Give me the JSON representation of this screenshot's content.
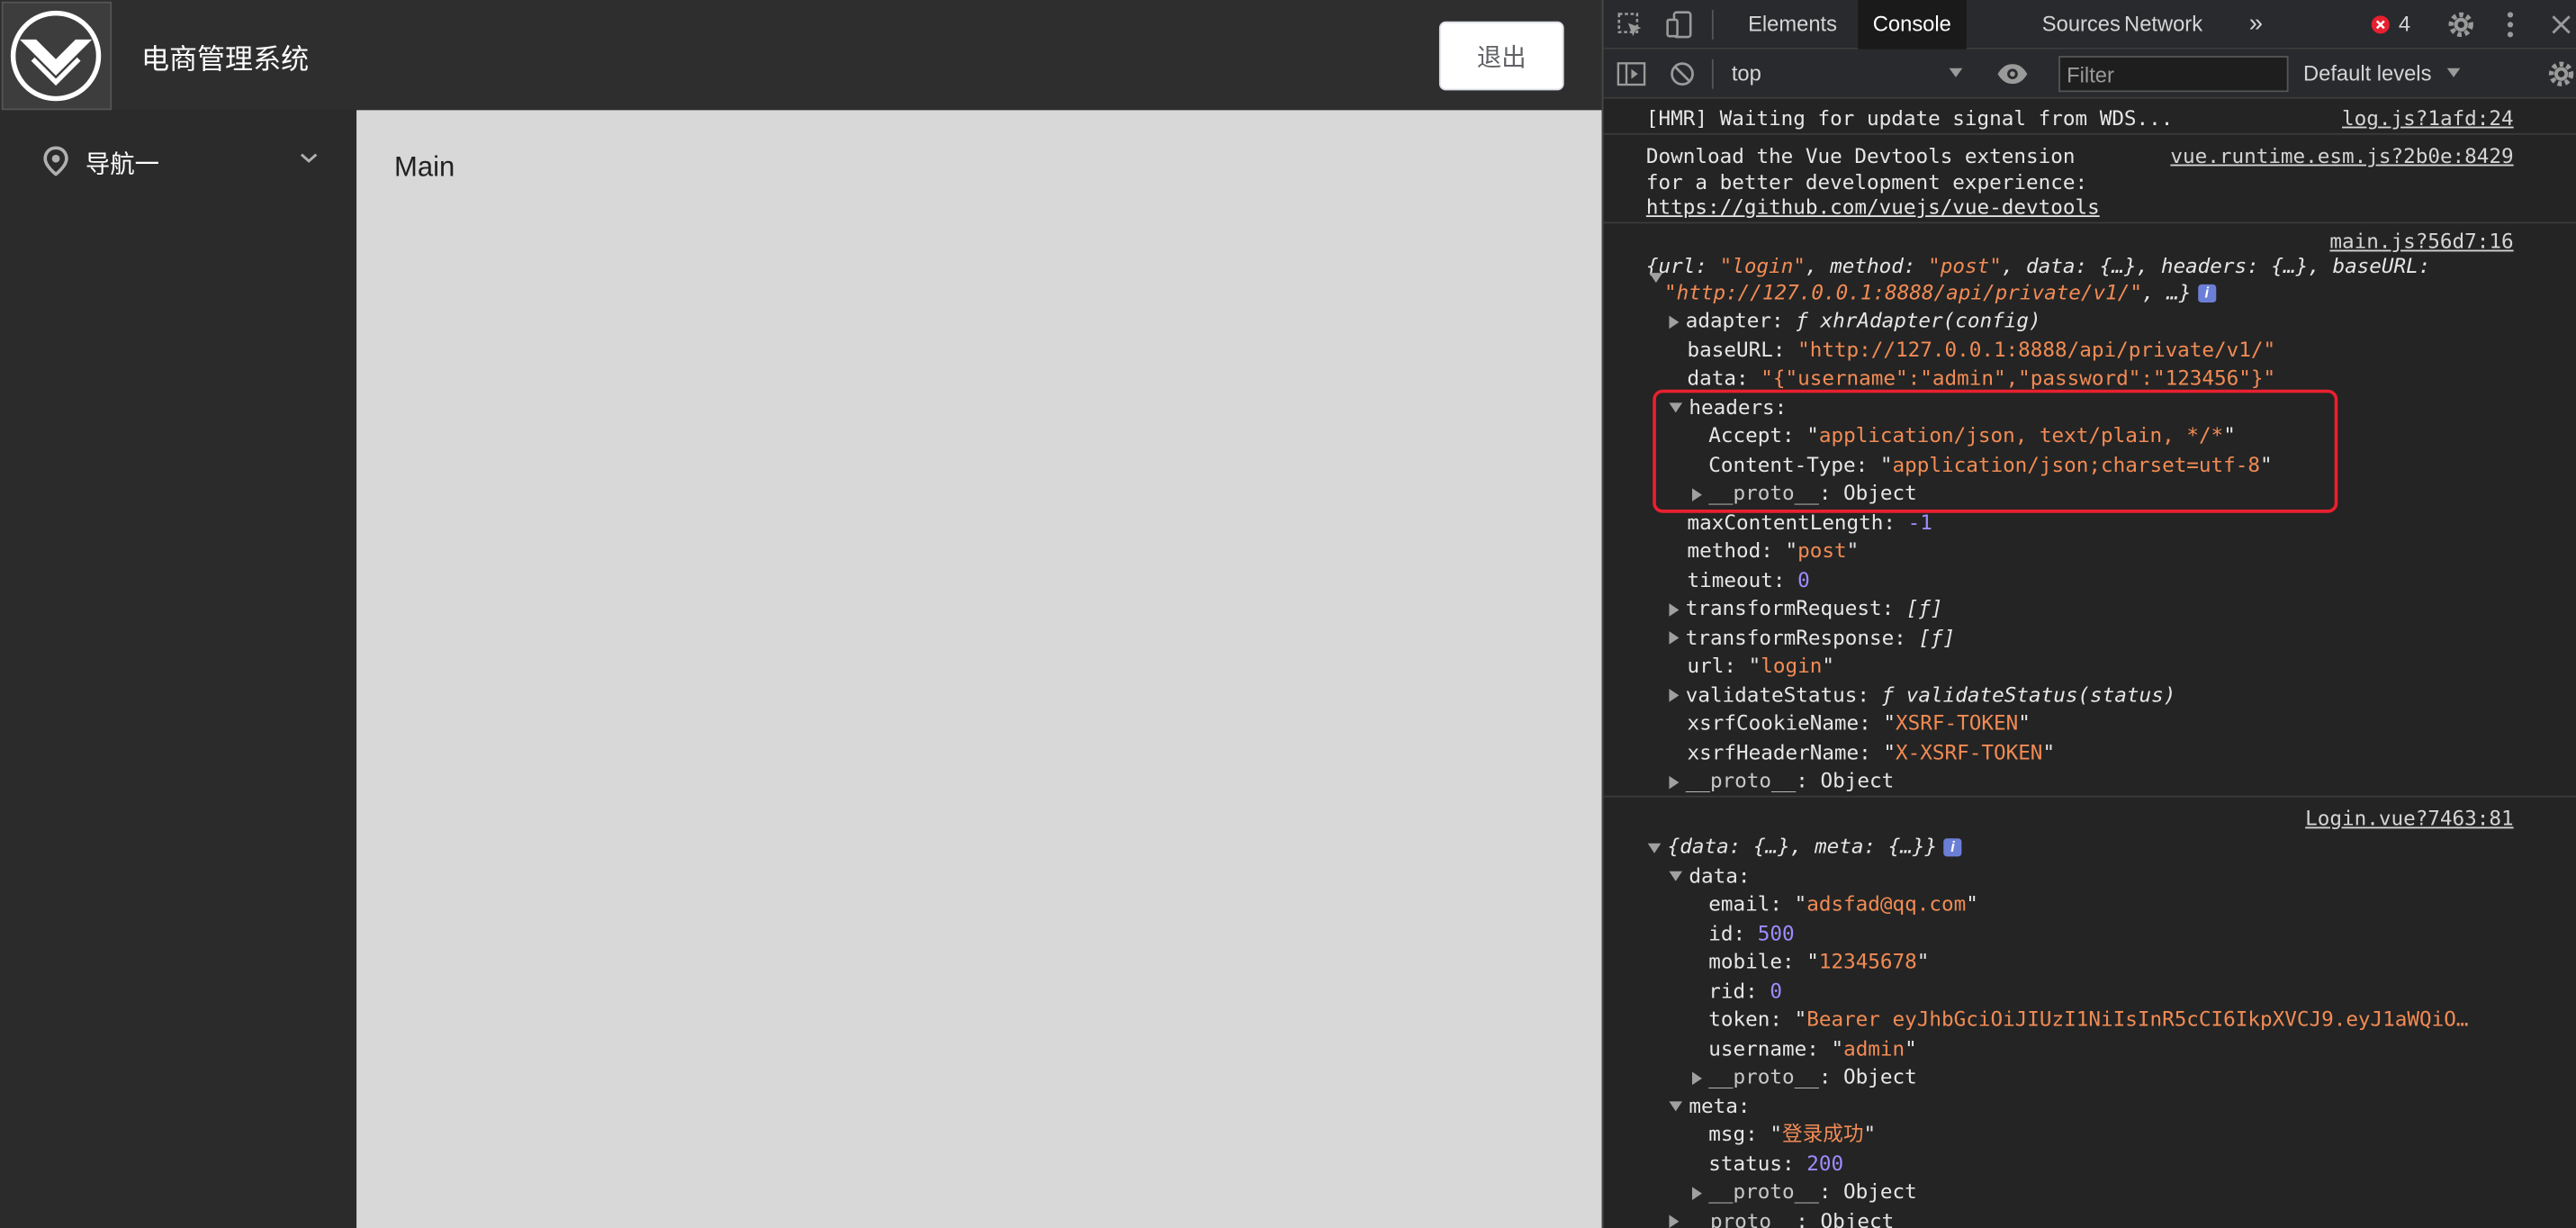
{
  "app": {
    "title": "电商管理系统",
    "logout_label": "退出",
    "nav_items": [
      {
        "label": "导航一"
      }
    ],
    "main_title": "Main"
  },
  "devtools": {
    "tabs": [
      "Elements",
      "Console",
      "Sources",
      "Network"
    ],
    "more_tabs_icon": "»",
    "error_count": "4",
    "context": "top",
    "filter_placeholder": "Filter",
    "levels": "Default levels",
    "colors": {
      "string": "#f28b54",
      "number": "#9e8cff",
      "error": "#e8202f",
      "highlight": "#e8202f"
    }
  },
  "console": {
    "msg1": {
      "text": "[HMR] Waiting for update signal from WDS...",
      "source": "log.js?1afd:24"
    },
    "msg2": {
      "line1": "Download the Vue Devtools extension",
      "line2": "for a better development experience:",
      "url": "https://github.com/vuejs/vue-devtools",
      "source": "vue.runtime.esm.js?2b0e:8429"
    },
    "msg3": {
      "source": "main.js?56d7:16",
      "summary_a": "{url: ",
      "summary_url": "\"login\"",
      "summary_b": ", method: ",
      "summary_method": "\"post\"",
      "summary_c": ", data: {…}, headers: {…}, baseURL:",
      "summary_base": "\"http://127.0.0.1:8888/api/private/v1/\"",
      "summary_end": ", …}",
      "adapter_key": "adapter: ",
      "adapter_val": "ƒ xhrAdapter(config)",
      "baseURL_key": "baseURL: ",
      "baseURL_val": "\"http://127.0.0.1:8888/api/private/v1/\"",
      "data_key": "data: ",
      "data_val": "\"{\"username\":\"admin\",\"password\":\"123456\"}\"",
      "headers_key": "headers:",
      "accept_key": "Accept: ",
      "accept_q1": "\"",
      "accept_val": "application/json, text/plain, */*",
      "accept_q2": "\"",
      "ctype_key": "Content-Type: ",
      "ctype_q1": "\"",
      "ctype_val": "application/json;charset=utf-8",
      "ctype_q2": "\"",
      "proto_key": "__proto__",
      "proto_val": ": Object",
      "maxcl_key": "maxContentLength: ",
      "maxcl_val": "-1",
      "method_key": "method: ",
      "method_q1": "\"",
      "method_val": "post",
      "method_q2": "\"",
      "timeout_key": "timeout: ",
      "timeout_val": "0",
      "treq_key": "transformRequest: ",
      "treq_val": "[ƒ]",
      "tres_key": "transformResponse: ",
      "tres_val": "[ƒ]",
      "url_key": "url: ",
      "url_q1": "\"",
      "url_val": "login",
      "url_q2": "\"",
      "vs_key": "validateStatus: ",
      "vs_val": "ƒ validateStatus(status)",
      "xc_key": "xsrfCookieName: ",
      "xc_q1": "\"",
      "xc_val": "XSRF-TOKEN",
      "xc_q2": "\"",
      "xh_key": "xsrfHeaderName: ",
      "xh_q1": "\"",
      "xh_val": "X-XSRF-TOKEN",
      "xh_q2": "\"",
      "proto2_key": "__proto__",
      "proto2_val": ": Object"
    },
    "msg4": {
      "source": "Login.vue?7463:81",
      "summary": "{data: {…}, meta: {…}}",
      "data_key": "data:",
      "email_key": "email: ",
      "email_q1": "\"",
      "email_val": "adsfad@qq.com",
      "email_q2": "\"",
      "id_key": "id: ",
      "id_val": "500",
      "mobile_key": "mobile: ",
      "mobile_q1": "\"",
      "mobile_val": "12345678",
      "mobile_q2": "\"",
      "rid_key": "rid: ",
      "rid_val": "0",
      "token_key": "token: ",
      "token_q1": "\"",
      "token_val": "Bearer eyJhbGciOiJIUzI1NiIsInR5cCI6IkpXVCJ9.eyJ1aWQiO…",
      "username_key": "username: ",
      "username_q1": "\"",
      "username_val": "admin",
      "username_q2": "\"",
      "proto_key": "__proto__",
      "proto_val": ": Object",
      "meta_key": "meta:",
      "msg_key": "msg: ",
      "msg_q1": "\"",
      "msg_val": "登录成功",
      "msg_q2": "\"",
      "status_key": "status: ",
      "status_val": "200",
      "proto3_key": "__proto__",
      "proto3_val": ": Object",
      "proto4_key": "__proto__",
      "proto4_val": ": Object"
    }
  }
}
